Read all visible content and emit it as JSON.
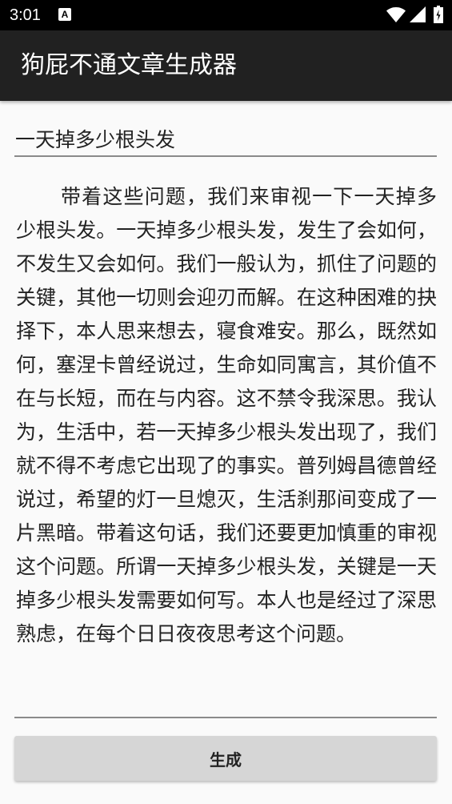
{
  "status_bar": {
    "time": "3:01",
    "notification_icon": "A"
  },
  "app_bar": {
    "title": "狗屁不通文章生成器"
  },
  "form": {
    "title_value": "一天掉多少根头发",
    "article_text": "带着这些问题，我们来审视一下一天掉多少根头发。一天掉多少根头发，发生了会如何，不发生又会如何。我们一般认为，抓住了问题的关键，其他一切则会迎刃而解。在这种困难的抉择下，本人思来想去，寝食难安。那么，既然如何，塞涅卡曾经说过，生命如同寓言，其价值不在与长短，而在与内容。这不禁令我深思。我认为，生活中，若一天掉多少根头发出现了，我们就不得不考虑它出现了的事实。普列姆昌德曾经说过，希望的灯一旦熄灭，生活刹那间变成了一片黑暗。带着这句话，我们还要更加慎重的审视这个问题。所谓一天掉多少根头发，关键是一天掉多少根头发需要如何写。本人也是经过了深思熟虑，在每个日日夜夜思考这个问题。",
    "generate_label": "生成"
  },
  "icons": {
    "wifi": "wifi-icon",
    "signal": "signal-icon",
    "battery": "battery-icon"
  }
}
